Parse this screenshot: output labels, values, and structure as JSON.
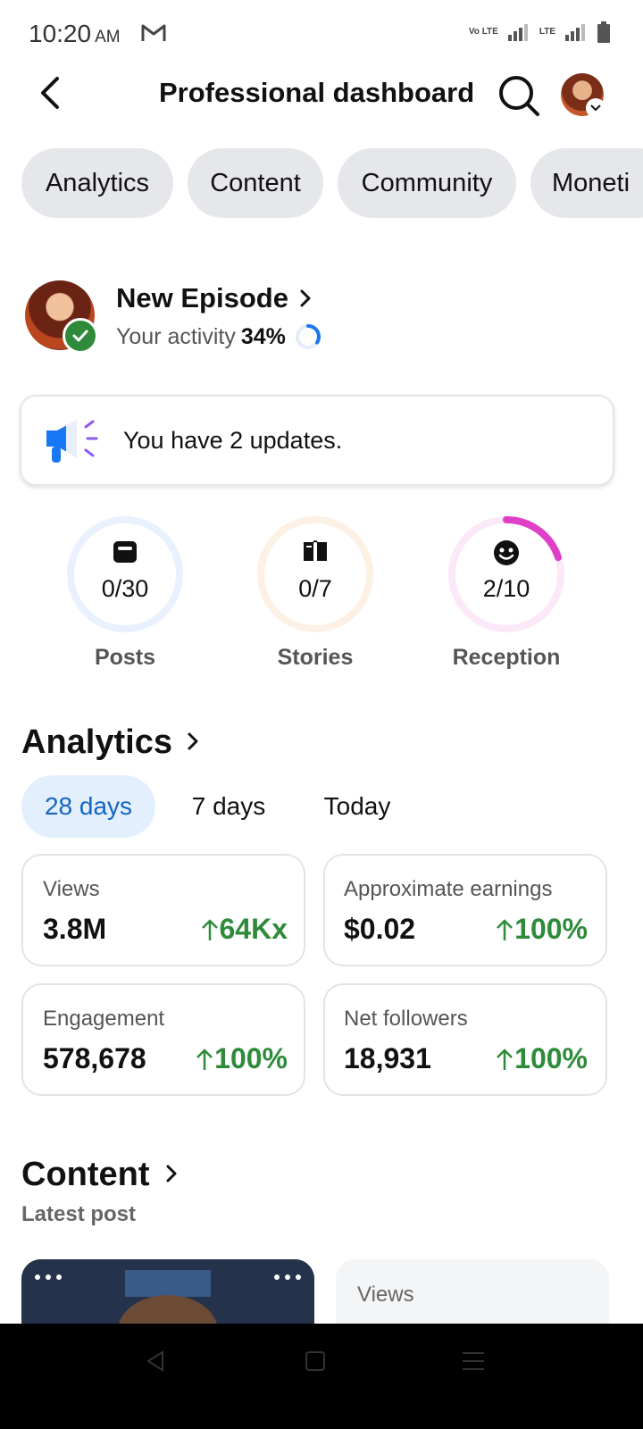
{
  "status_bar": {
    "time": "10:20",
    "ampm": "AM",
    "volte": "Vo LTE",
    "lte": "LTE"
  },
  "header": {
    "title": "Professional dashboard"
  },
  "tabs": [
    {
      "label": "Analytics"
    },
    {
      "label": "Content"
    },
    {
      "label": "Community"
    },
    {
      "label": "Moneti"
    }
  ],
  "profile": {
    "name": "New Episode",
    "activity_label": "Your activity",
    "activity_percent": "34%",
    "activity_progress": 0.34
  },
  "updates": {
    "text": "You have 2 updates."
  },
  "goals": [
    {
      "value": "0/30",
      "label": "Posts",
      "progress": 0.0,
      "color": "#1877f2"
    },
    {
      "value": "0/7",
      "label": "Stories",
      "progress": 0.0,
      "color": "#f5a04a"
    },
    {
      "value": "2/10",
      "label": "Reception",
      "progress": 0.2,
      "color": "#e040c8"
    }
  ],
  "analytics": {
    "title": "Analytics",
    "ranges": [
      {
        "label": "28 days",
        "selected": true
      },
      {
        "label": "7 days",
        "selected": false
      },
      {
        "label": "Today",
        "selected": false
      }
    ],
    "metrics": [
      {
        "label": "Views",
        "value": "3.8M",
        "change": "64Kx"
      },
      {
        "label": "Approximate earnings",
        "value": "$0.02",
        "change": "100%"
      },
      {
        "label": "Engagement",
        "value": "578,678",
        "change": "100%"
      },
      {
        "label": "Net followers",
        "value": "18,931",
        "change": "100%"
      }
    ]
  },
  "content": {
    "title": "Content",
    "subtitle": "Latest post",
    "views_label": "Views"
  },
  "colors": {
    "accent": "#1877f2",
    "positive": "#2e8b3a",
    "chip_bg": "#e5e7eb"
  }
}
